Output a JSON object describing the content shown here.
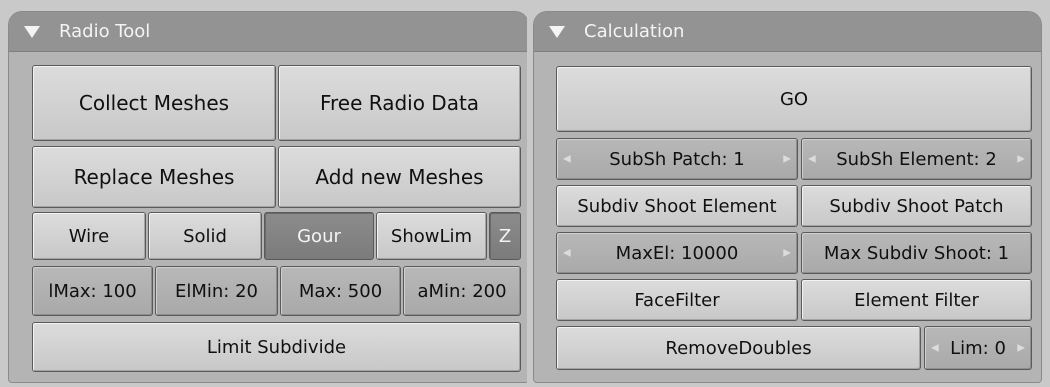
{
  "radio_tool": {
    "title": "Radio Tool",
    "collect_meshes": "Collect Meshes",
    "free_radio_data": "Free Radio Data",
    "replace_meshes": "Replace Meshes",
    "add_new_meshes": "Add new Meshes",
    "wire": "Wire",
    "solid": "Solid",
    "gour": "Gour",
    "show_lim": "ShowLim",
    "z": "Z",
    "imax": "lMax: 100",
    "elmin": "ElMin: 20",
    "pmax": "Max: 500",
    "pmin": "aMin: 200",
    "limit_subdivide": "Limit Subdivide"
  },
  "calculation": {
    "title": "Calculation",
    "go": "GO",
    "subsh_patch": "SubSh Patch: 1",
    "subsh_element": "SubSh Element: 2",
    "subdiv_shoot_element": "Subdiv Shoot Element",
    "subdiv_shoot_patch": "Subdiv Shoot Patch",
    "max_el": "MaxEl: 10000",
    "max_subdiv_shoot": "Max Subdiv Shoot: 1",
    "face_filter": "FaceFilter",
    "element_filter": "Element Filter",
    "remove_doubles": "RemoveDoubles",
    "lim": "Lim: 0"
  },
  "colors": {
    "active_button": "#7f7f7f",
    "header": "#939393",
    "panel_body": "#b4b4b4"
  },
  "icons": {
    "collapse": "triangle-down-icon",
    "decrement": "arrow-left-icon",
    "increment": "arrow-right-icon"
  }
}
